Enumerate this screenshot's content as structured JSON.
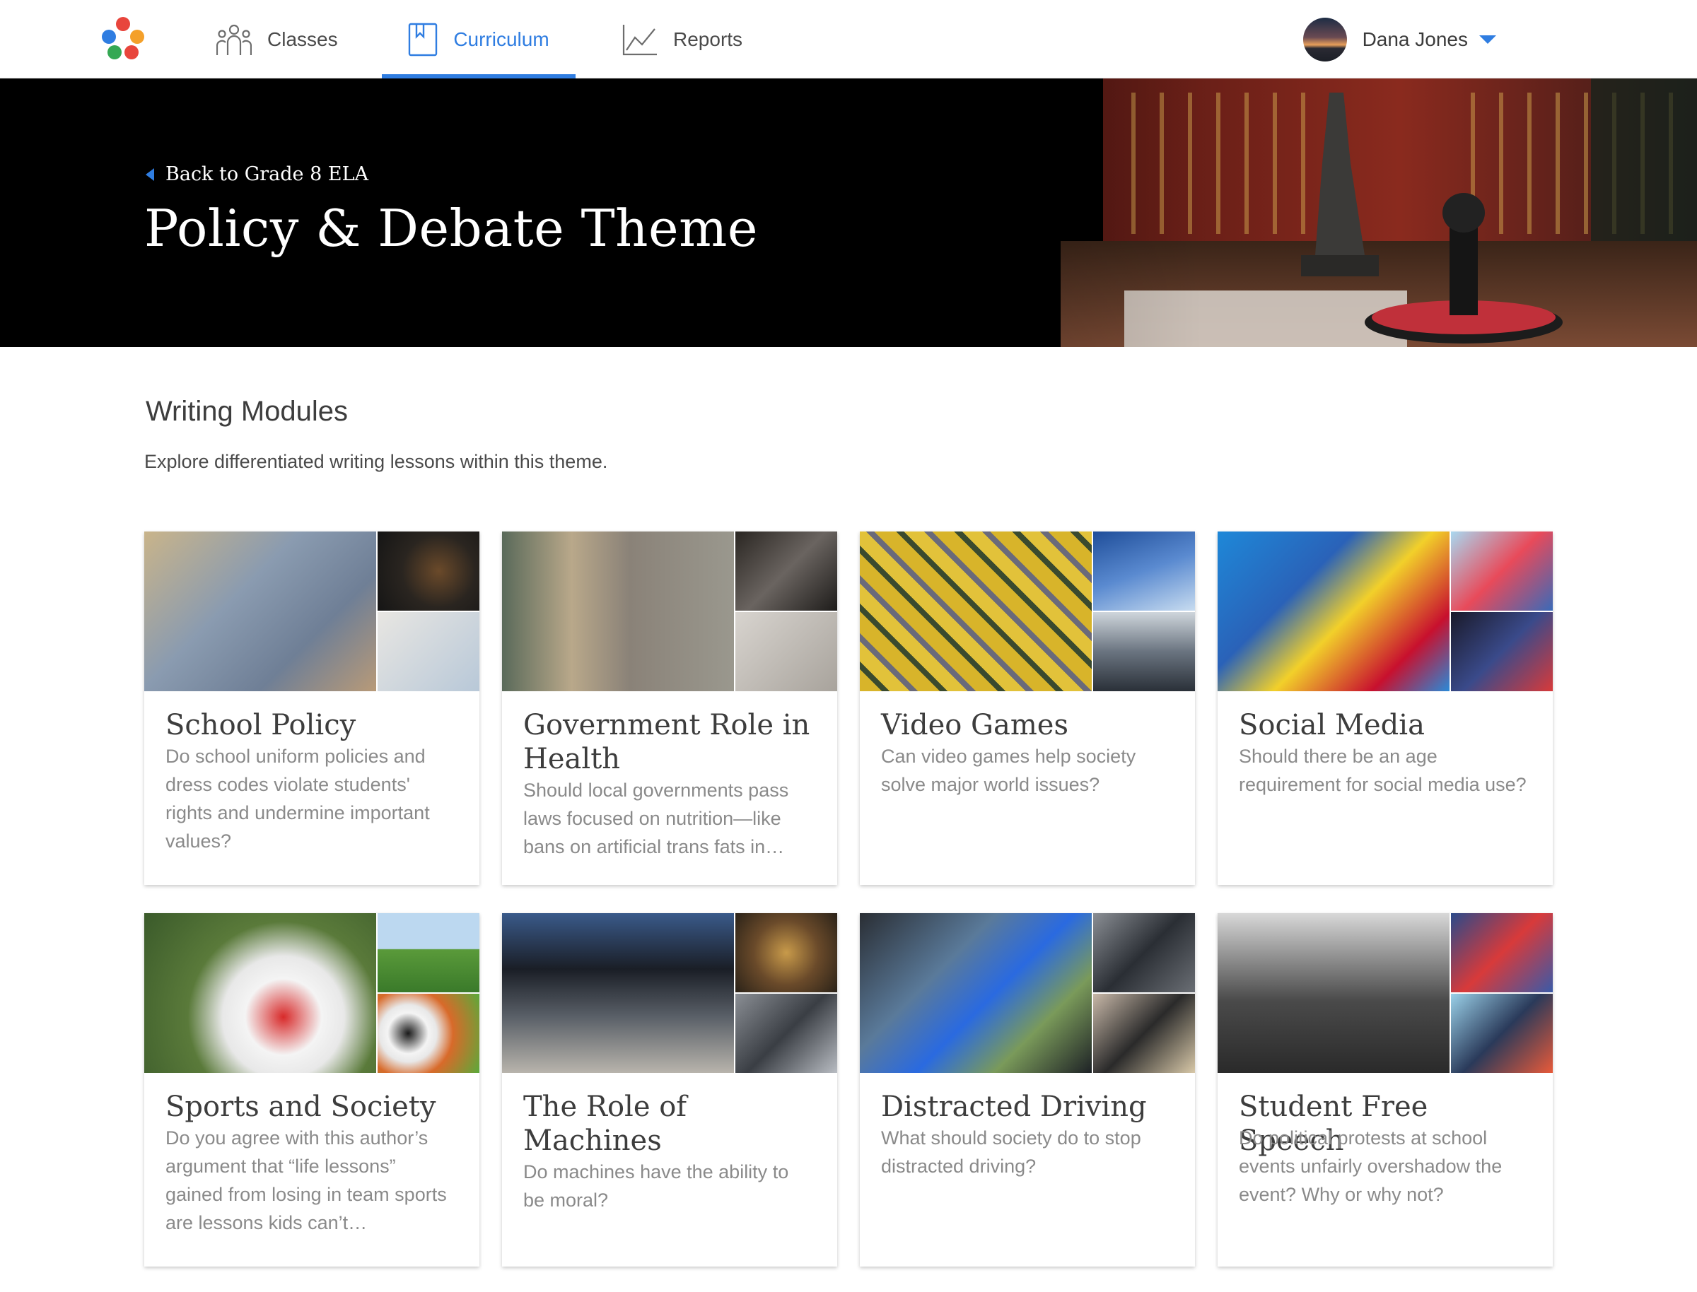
{
  "nav": {
    "tabs": [
      {
        "label": "Classes",
        "icon": "people-icon"
      },
      {
        "label": "Curriculum",
        "icon": "bookmark-book-icon",
        "active": true
      },
      {
        "label": "Reports",
        "icon": "line-chart-icon"
      }
    ],
    "user": {
      "name": "Dana Jones"
    },
    "accent_color": "#2f7de1",
    "logo_colors": [
      "#e8453c",
      "#2f7de1",
      "#f4a02a",
      "#34a853"
    ]
  },
  "hero": {
    "back_label": "Back to Grade 8 ELA",
    "title": "Policy & Debate Theme"
  },
  "section": {
    "title": "Writing Modules",
    "subtitle": "Explore differentiated writing lessons within this theme."
  },
  "modules": [
    {
      "title": "School Policy",
      "description": "Do school uniform policies and dress codes violate students' rights and undermine important values?"
    },
    {
      "title": "Government Role in Health",
      "description": "Should local governments pass laws focused on nutrition—like bans on artificial trans fats in…"
    },
    {
      "title": "Video Games",
      "description": "Can video games help society solve major world issues?"
    },
    {
      "title": "Social Media",
      "description": "Should there be an age requirement for social media use?"
    },
    {
      "title": "Sports and Society",
      "description": "Do you agree with this author’s argument that “life lessons” gained from losing in team sports are lessons kids can’t…"
    },
    {
      "title": "The Role of Machines",
      "description": "Do machines have the ability to be moral?"
    },
    {
      "title": "Distracted Driving",
      "description": "What should society do to stop distracted driving?"
    },
    {
      "title": "Student Free Speech",
      "description": "Do political protests at school events unfairly overshadow the event? Why or why not?"
    }
  ]
}
